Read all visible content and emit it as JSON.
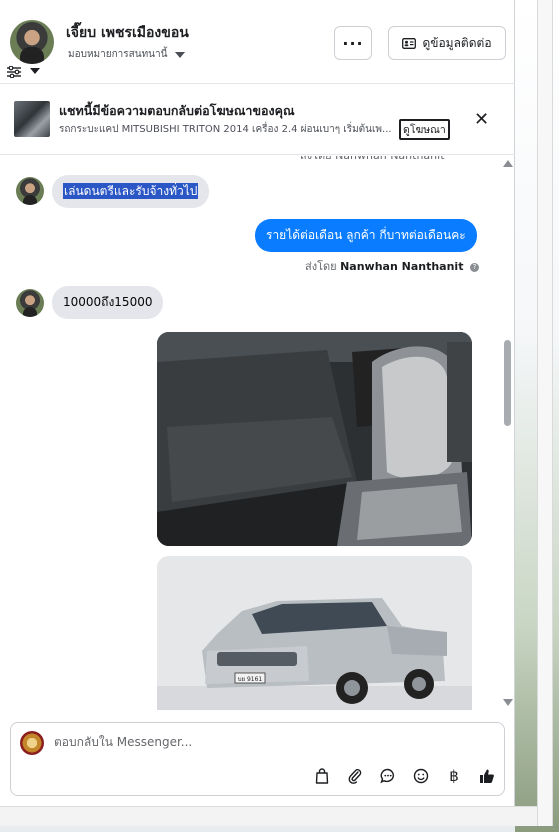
{
  "header": {
    "contact_name": "เจี๊ยบ เพชรเมืองขอน",
    "assign_label": "มอบหมายการสนทนานี้",
    "more_button": "···",
    "contact_info_button": "ดูข้อมูลติดต่อ"
  },
  "ad_banner": {
    "title": "แชทนี้มีข้อความตอบกลับต่อโฆษณาของคุณ",
    "subtitle": "รถกระบะแคป MITSUBISHI TRITON 2014 เครื่อง 2.4 ผ่อนเบาๆ เริ่มต้นเพ...",
    "view_ad_link": "ดูโฆษณา"
  },
  "messages": {
    "cut_top_text": "ส่งโดย Nanwhan Nanthanit",
    "incoming_1": "เล่นดนตรีและรับจ้างทั่วไป",
    "outgoing_1": "รายได้ต่อเดือน ลูกค้า กี่บาทต่อเดือนคะ",
    "sent_by_prefix": "ส่งโดย",
    "sent_by_name": "Nanwhan Nanthanit",
    "incoming_2": "10000ถึง15000",
    "plate_text": "บย 9161"
  },
  "composer": {
    "placeholder": "ตอบกลับใน Messenger..."
  },
  "icons": [
    "filter-icon",
    "more-icon",
    "contact-card-icon",
    "close-icon",
    "info-icon",
    "bag-icon",
    "paperclip-icon",
    "chat-bubble-icon",
    "emoji-icon",
    "baht-icon",
    "thumbs-up-icon"
  ],
  "colors": {
    "outgoing_bubble": "#0a7cff",
    "incoming_bubble": "#e4e6eb",
    "highlight": "#2a56c6"
  }
}
